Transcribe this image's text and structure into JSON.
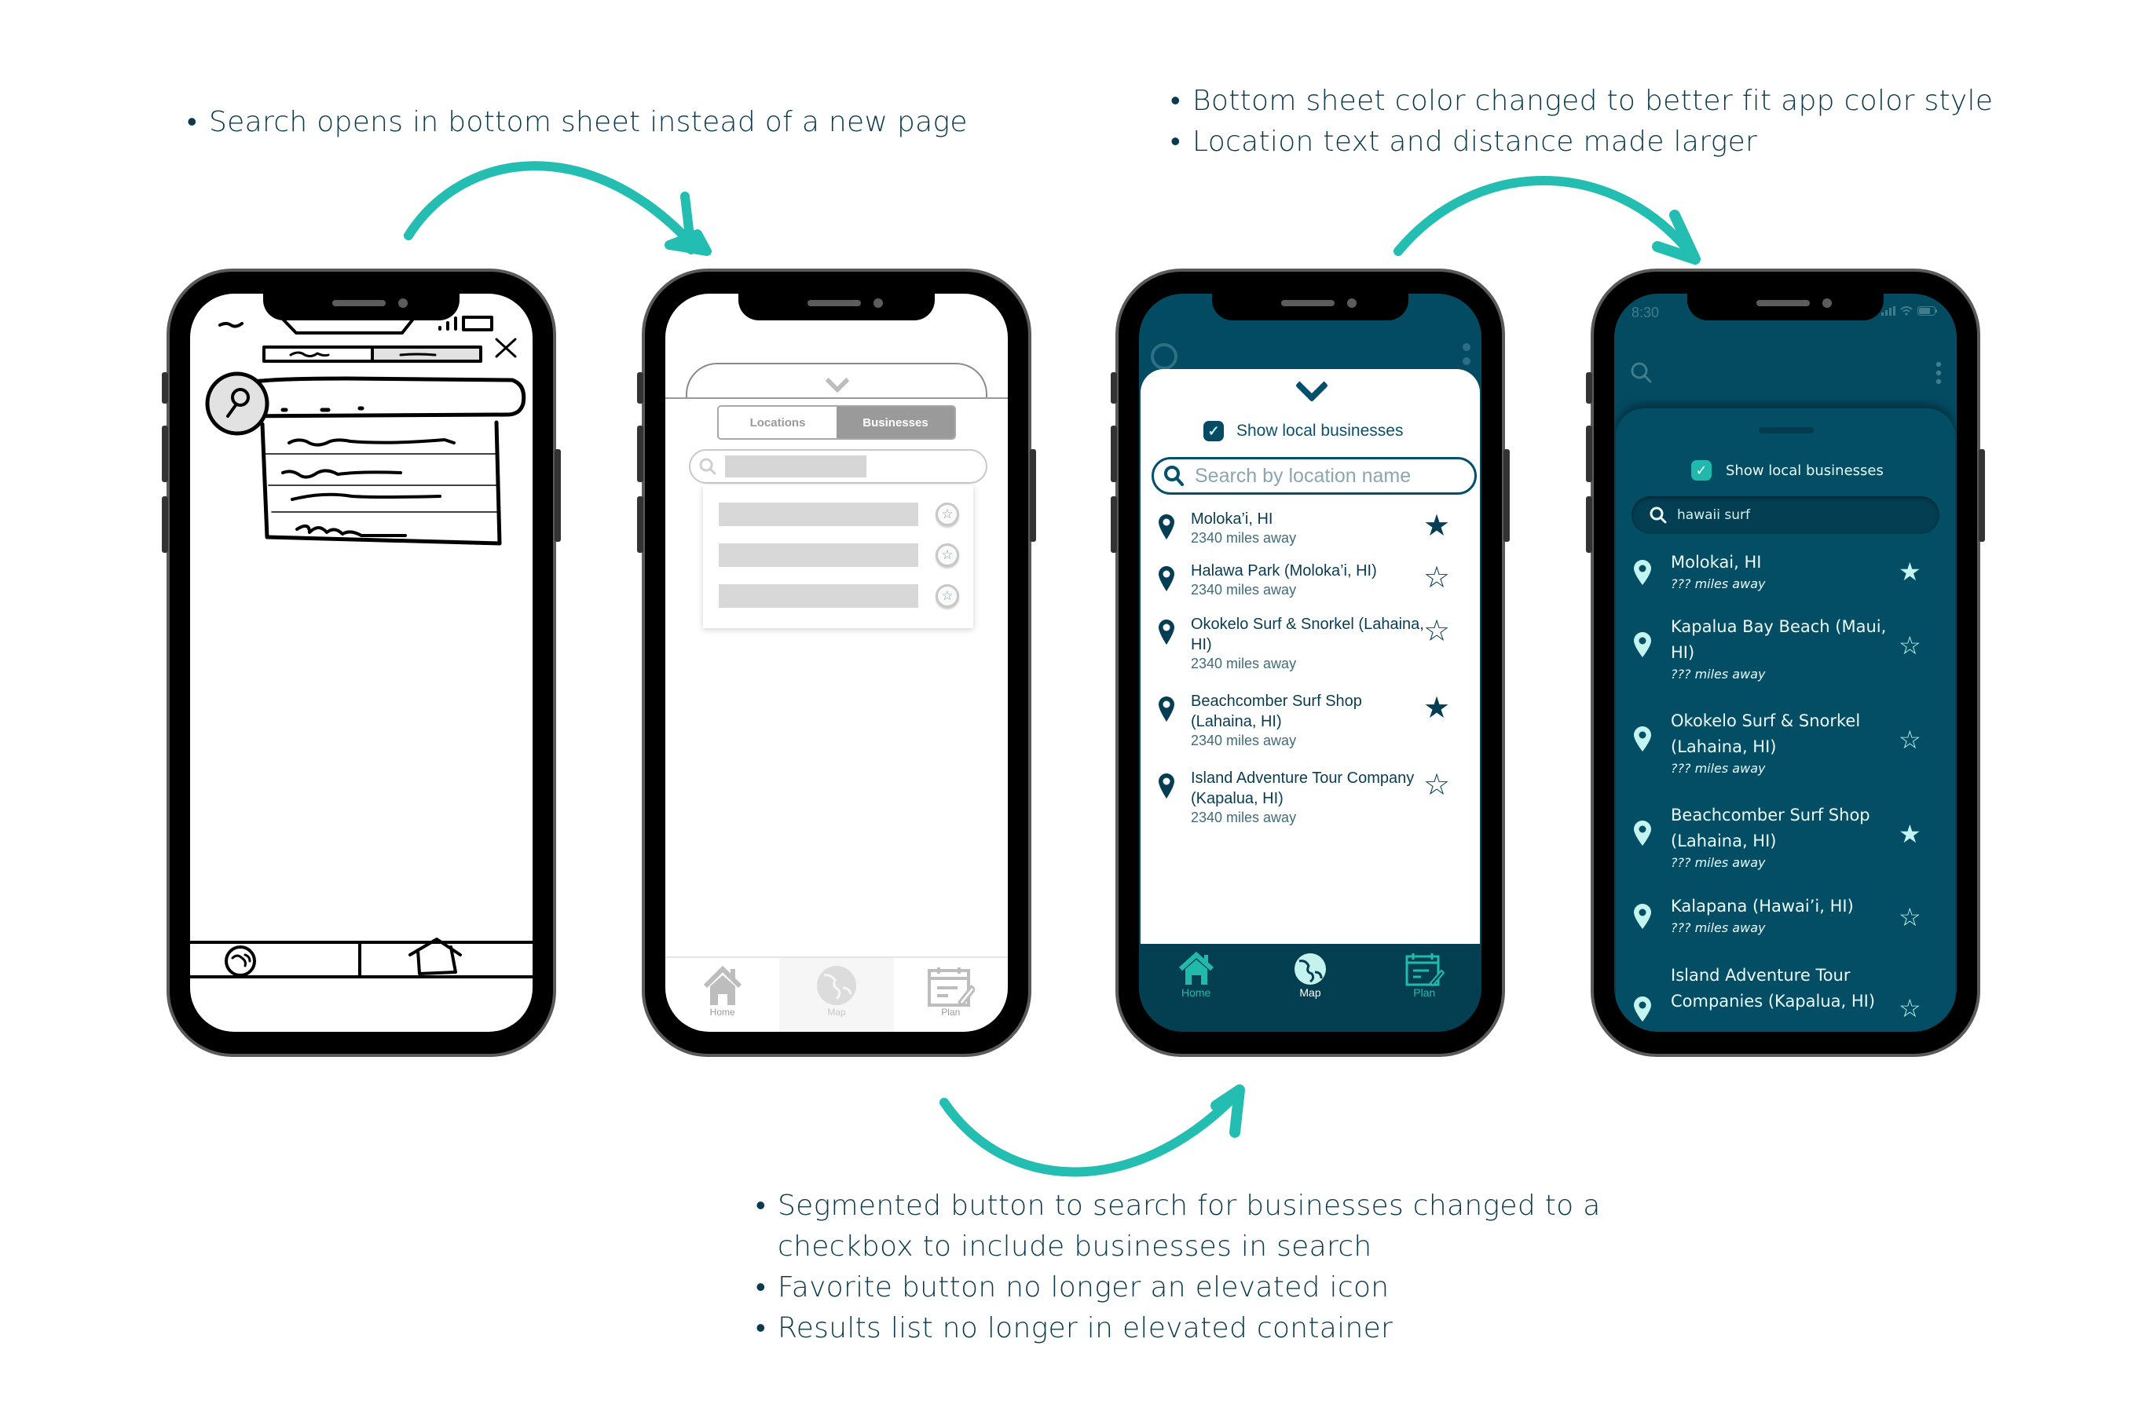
{
  "notes": {
    "top_left": [
      "Search opens in bottom sheet instead of a new page"
    ],
    "top_right": [
      "Bottom sheet color changed to better fit app color style",
      "Location text and distance made larger"
    ],
    "bottom": [
      "Segmented button to search for businesses changed to a checkbox to include businesses in search",
      "Favorite button no longer an elevated icon",
      "Results list no longer in elevated container"
    ]
  },
  "colors": {
    "accent_teal": "#23bdb1",
    "primary_dark": "#034b63",
    "note_text": "#0b3a4d"
  },
  "phone1": {
    "description": "hand-drawn sketch",
    "tabs": [
      "map-globe-icon",
      "home-icon"
    ]
  },
  "phone2": {
    "segmented": {
      "options": [
        "Locations",
        "Businesses"
      ],
      "selected": "Businesses"
    },
    "rows": 3,
    "tabbar": [
      {
        "label": "Home",
        "icon": "home-icon"
      },
      {
        "label": "Map",
        "icon": "globe-icon",
        "active": true
      },
      {
        "label": "Plan",
        "icon": "calendar-edit-icon"
      }
    ]
  },
  "phone3": {
    "checkbox_label": "Show local businesses",
    "checkbox_checked": true,
    "search_placeholder": "Search by location name",
    "results": [
      {
        "name": "Moloka’i, HI",
        "distance": "2340 miles away",
        "favorite": true
      },
      {
        "name": "Halawa Park (Moloka’i, HI)",
        "distance": "2340 miles away",
        "favorite": false
      },
      {
        "name": "Okokelo Surf & Snorkel (Lahaina, HI)",
        "distance": "2340 miles away",
        "favorite": false
      },
      {
        "name": "Beachcomber Surf Shop (Lahaina, HI)",
        "distance": "2340 miles away",
        "favorite": true
      },
      {
        "name": "Island Adventure Tour Company (Kapalua, HI)",
        "distance": "2340 miles away",
        "favorite": false
      }
    ],
    "tabbar": [
      {
        "label": "Home",
        "icon": "home-icon"
      },
      {
        "label": "Map",
        "icon": "globe-icon",
        "active": true
      },
      {
        "label": "Plan",
        "icon": "calendar-edit-icon"
      }
    ]
  },
  "phone4": {
    "status_time": "8:30",
    "checkbox_label": "Show local businesses",
    "checkbox_checked": true,
    "search_value": "hawaii surf",
    "results": [
      {
        "name": "Molokai, HI",
        "distance": "??? miles away",
        "favorite": true
      },
      {
        "name": "Kapalua Bay Beach (Maui, HI)",
        "distance": "??? miles away",
        "favorite": false
      },
      {
        "name": "Okokelo Surf & Snorkel (Lahaina, HI)",
        "distance": "??? miles away",
        "favorite": false
      },
      {
        "name": "Beachcomber Surf Shop (Lahaina, HI)",
        "distance": "??? miles away",
        "favorite": true
      },
      {
        "name": "Kalapana (Hawai’i, HI)",
        "distance": "??? miles away",
        "favorite": false
      },
      {
        "name": "Island Adventure Tour Companies (Kapalua, HI)",
        "distance": "",
        "favorite": false
      }
    ]
  }
}
